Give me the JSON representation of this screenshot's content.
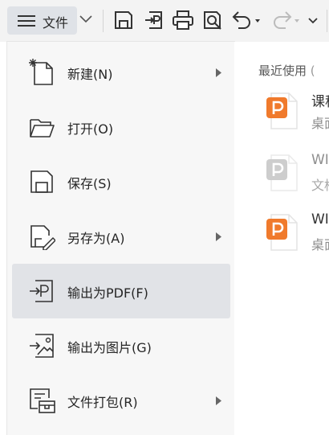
{
  "toolbar": {
    "file_menu_label": "文件",
    "icons": [
      "hamburger-icon",
      "chevron-down-icon",
      "save-icon",
      "export-pdf-icon",
      "print-icon",
      "print-preview-icon",
      "undo-icon",
      "redo-icon",
      "more-icon"
    ]
  },
  "file_menu": {
    "items": [
      {
        "label": "新建(N)",
        "icon": "new-document-icon",
        "has_submenu": true
      },
      {
        "label": "打开(O)",
        "icon": "open-folder-icon",
        "has_submenu": false
      },
      {
        "label": "保存(S)",
        "icon": "save-icon",
        "has_submenu": false
      },
      {
        "label": "另存为(A)",
        "icon": "save-as-icon",
        "has_submenu": true
      },
      {
        "label": "输出为PDF(F)",
        "icon": "export-pdf-icon",
        "has_submenu": false,
        "active": true
      },
      {
        "label": "输出为图片(G)",
        "icon": "export-image-icon",
        "has_submenu": false
      },
      {
        "label": "文件打包(R)",
        "icon": "package-icon",
        "has_submenu": true
      }
    ]
  },
  "recent": {
    "title": "最近使用",
    "title_suffix": "(",
    "files": [
      {
        "name": "课程",
        "location": "桌面",
        "type": "presentation",
        "dim": false
      },
      {
        "name": "WI",
        "location": "文档",
        "type": "presentation",
        "dim": true
      },
      {
        "name": "WI",
        "location": "桌面",
        "type": "presentation",
        "dim": false
      }
    ]
  },
  "colors": {
    "accent_orange": "#f07a2c",
    "active_bg": "#e1e3e7",
    "panel_bg": "#f7f7f7"
  }
}
